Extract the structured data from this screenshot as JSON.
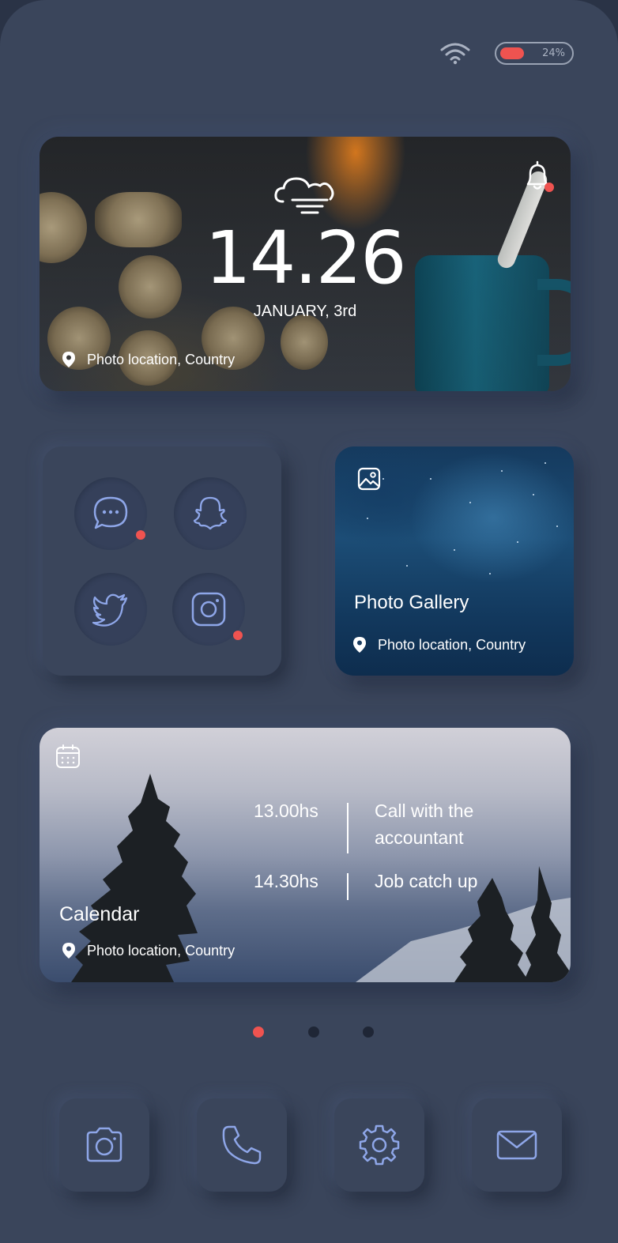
{
  "status_bar": {
    "wifi_icon": "wifi-icon",
    "battery_percent_text": "24%",
    "battery_level": 0.24,
    "battery_color": "#ef5350"
  },
  "clock_widget": {
    "weather_icon": "cloud-wind-icon",
    "time": "14.26",
    "date": "JANUARY, 3rd",
    "bell_icon": "bell-icon",
    "has_notification": true,
    "location": "Photo location, Country"
  },
  "apps_widget": {
    "apps": [
      {
        "name": "messages",
        "icon": "chat-bubble-icon",
        "notification": true
      },
      {
        "name": "snapchat",
        "icon": "snapchat-ghost-icon",
        "notification": false
      },
      {
        "name": "twitter",
        "icon": "twitter-bird-icon",
        "notification": false
      },
      {
        "name": "instagram",
        "icon": "instagram-icon",
        "notification": true
      }
    ]
  },
  "gallery_widget": {
    "icon": "image-icon",
    "title": "Photo Gallery",
    "location": "Photo location, Country"
  },
  "calendar_widget": {
    "icon": "calendar-icon",
    "title": "Calendar",
    "location": "Photo location, Country",
    "events": [
      {
        "time": "13.00hs",
        "title_line1": "Call with the",
        "title_line2": "accountant"
      },
      {
        "time": "14.30hs",
        "title_line1": "Job catch up",
        "title_line2": ""
      }
    ]
  },
  "pagination": {
    "pages": 3,
    "active_page": 1,
    "active_color": "#ef5350",
    "inactive_color": "#1f2636"
  },
  "dock": {
    "apps": [
      {
        "name": "camera",
        "icon": "camera-icon"
      },
      {
        "name": "phone",
        "icon": "phone-icon"
      },
      {
        "name": "settings",
        "icon": "gear-icon"
      },
      {
        "name": "mail",
        "icon": "mail-icon"
      }
    ]
  },
  "colors": {
    "background": "#3a455b",
    "accent": "#ef5350",
    "icon_stroke": "#8ea6e8"
  }
}
